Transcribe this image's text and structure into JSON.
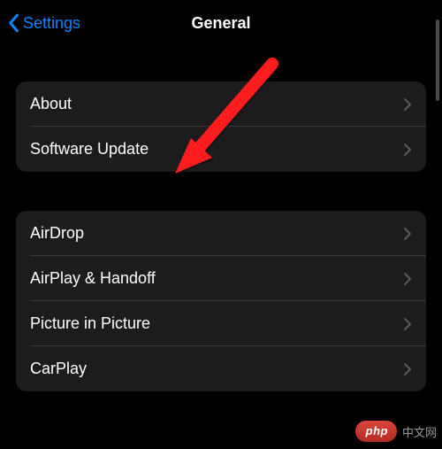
{
  "header": {
    "back_label": "Settings",
    "title": "General"
  },
  "groups": [
    {
      "items": [
        {
          "label": "About"
        },
        {
          "label": "Software Update"
        }
      ]
    },
    {
      "items": [
        {
          "label": "AirDrop"
        },
        {
          "label": "AirPlay & Handoff"
        },
        {
          "label": "Picture in Picture"
        },
        {
          "label": "CarPlay"
        }
      ]
    }
  ],
  "watermark": {
    "badge": "php",
    "text": "中文网"
  }
}
